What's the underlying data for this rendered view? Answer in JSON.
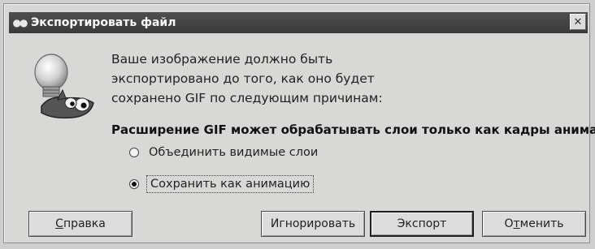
{
  "window": {
    "title": "Экспортировать файл",
    "close_glyph": "✕",
    "app_icon": "gimp-eyes-icon"
  },
  "body": {
    "message_lines": [
      "Ваше изображение должно быть",
      "экспортировано до того, как оно будет",
      "сохранено GIF по следующим причинам:"
    ],
    "reason": "Расширение GIF может обрабатывать слои только как кадры анимации",
    "options": [
      {
        "label": "Объединить видимые слои",
        "selected": false
      },
      {
        "label": "Сохранить как анимацию",
        "selected": true
      }
    ]
  },
  "buttons": {
    "help": {
      "accel": "С",
      "rest": "правка"
    },
    "ignore": "Игнорировать",
    "export": "Экспорт",
    "cancel": {
      "pre": "О",
      "accel": "т",
      "rest": "менить"
    }
  },
  "colors": {
    "titlebar": "#3f3f3f",
    "dialog_bg": "#d8d8d6"
  }
}
